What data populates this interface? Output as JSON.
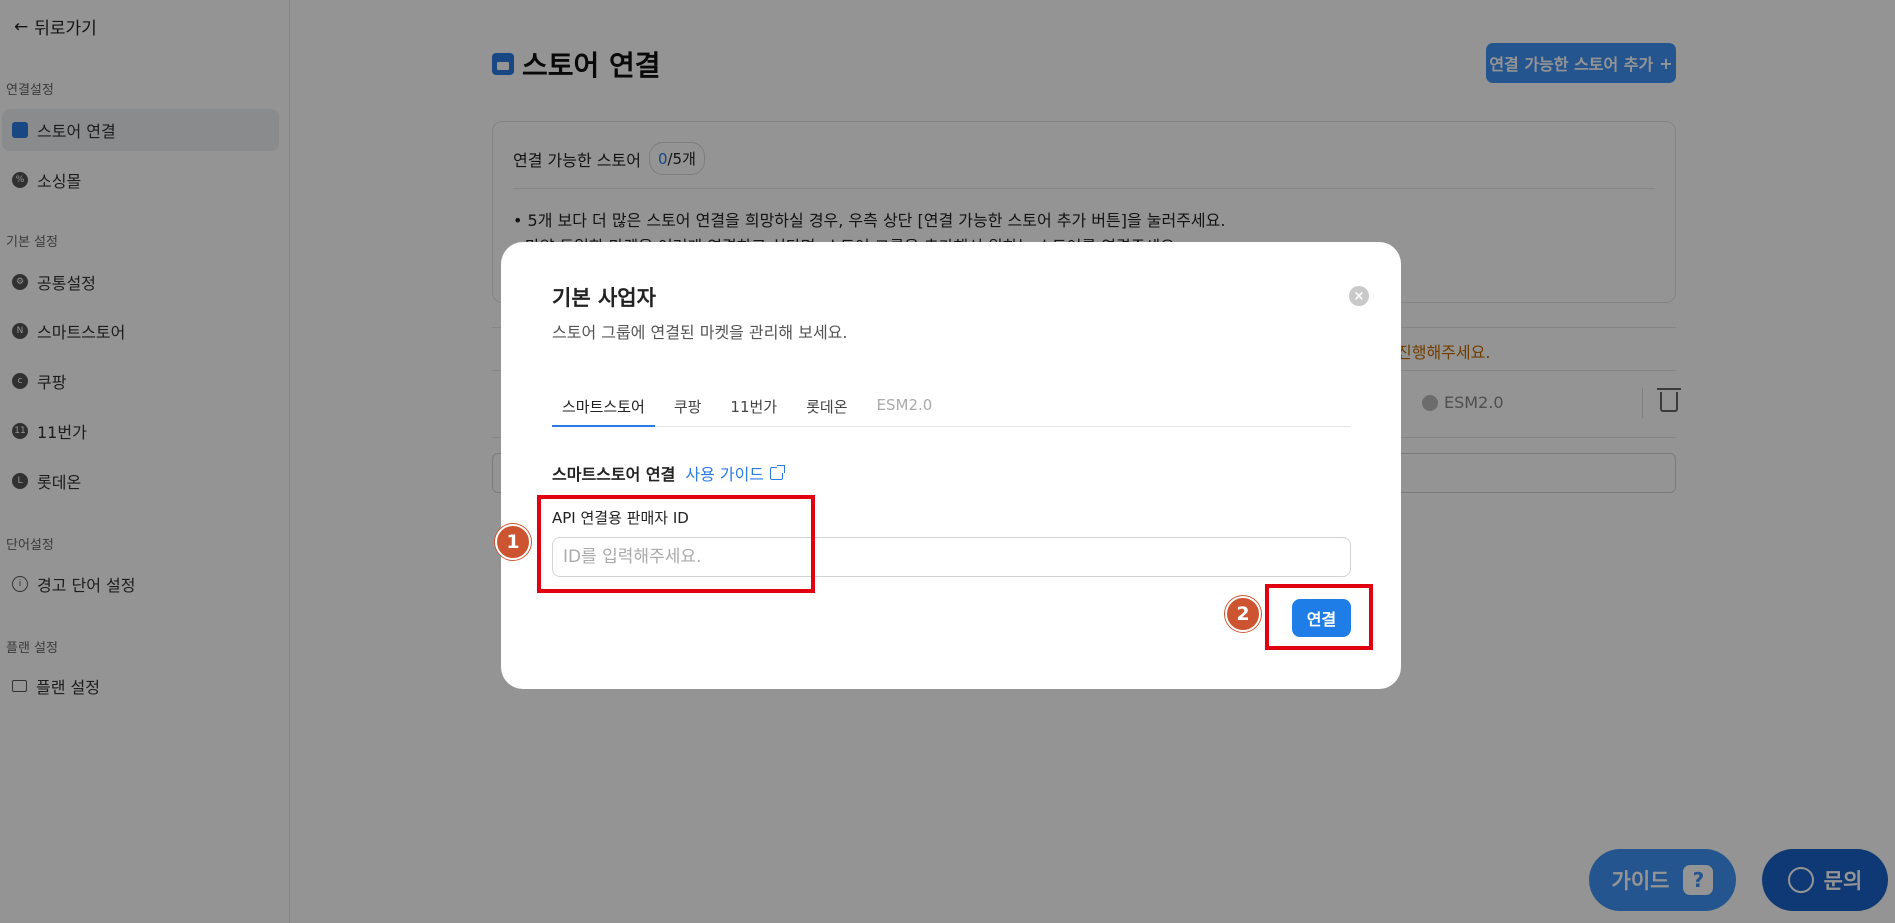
{
  "sidebar": {
    "back_label": "뒤로가기",
    "sections": [
      {
        "label": "연결설정"
      },
      {
        "label": "기본 설정"
      },
      {
        "label": "단어설정"
      },
      {
        "label": "플랜 설정"
      }
    ],
    "items": [
      {
        "label": "스토어 연결",
        "icon": "store-icon",
        "active": true
      },
      {
        "label": "소싱몰",
        "icon": "sourcing-icon"
      },
      {
        "label": "공통설정",
        "icon": "gear-icon"
      },
      {
        "label": "스마트스토어",
        "icon": "naver-icon"
      },
      {
        "label": "쿠팡",
        "icon": "coupang-icon"
      },
      {
        "label": "11번가",
        "icon": "11st-icon"
      },
      {
        "label": "롯데온",
        "icon": "lotteon-icon"
      },
      {
        "label": "경고 단어 설정",
        "icon": "info-icon"
      },
      {
        "label": "플랜 설정",
        "icon": "card-icon"
      }
    ]
  },
  "page": {
    "title": "스토어 연결",
    "add_store_button": "연결 가능한 스토어 추가",
    "add_store_button_icon": "+",
    "panel": {
      "head_label": "연결 가능한 스토어",
      "count_current": "0",
      "count_total": "/5개",
      "notice_line1": "• 5개 보다 더 많은 스토어 연결을 희망하실 경우, 우측 상단 [연결 가능한 스토어 추가 버튼]을 눌러주세요.",
      "notice_line2": "만약 동일한 마켓을 여러개 연결하고 싶다면, 스토어 그룹을 추가해서 원하는 스토어를 연결주세요."
    },
    "warning_partial": "진행해주세요.",
    "market_chip": "ESM2.0"
  },
  "modal": {
    "title": "기본 사업자",
    "subtitle": "스토어 그룹에 연결된 마켓을 관리해 보세요.",
    "close_glyph": "×",
    "tabs": [
      {
        "label": "스마트스토어",
        "state": "active"
      },
      {
        "label": "쿠팡",
        "state": "normal"
      },
      {
        "label": "11번가",
        "state": "normal"
      },
      {
        "label": "롯데온",
        "state": "normal"
      },
      {
        "label": "ESM2.0",
        "state": "disabled"
      }
    ],
    "section_title": "스마트스토어 연결",
    "guide_link": "사용 가이드",
    "field_label": "API 연결용 판매자 ID",
    "id_input": {
      "value": "",
      "placeholder": "ID를 입력해주세요."
    },
    "connect_button": "연결"
  },
  "annotations": {
    "step1": "1",
    "step2": "2",
    "highlight_color": "#e1000f",
    "badge_color": "#cd5431"
  },
  "fabs": {
    "guide_label": "가이드",
    "guide_icon_glyph": "?",
    "ask_label": "문의"
  },
  "colors": {
    "accent": "#2b7be4",
    "overlay": "rgba(0,0,0,0.42)"
  }
}
